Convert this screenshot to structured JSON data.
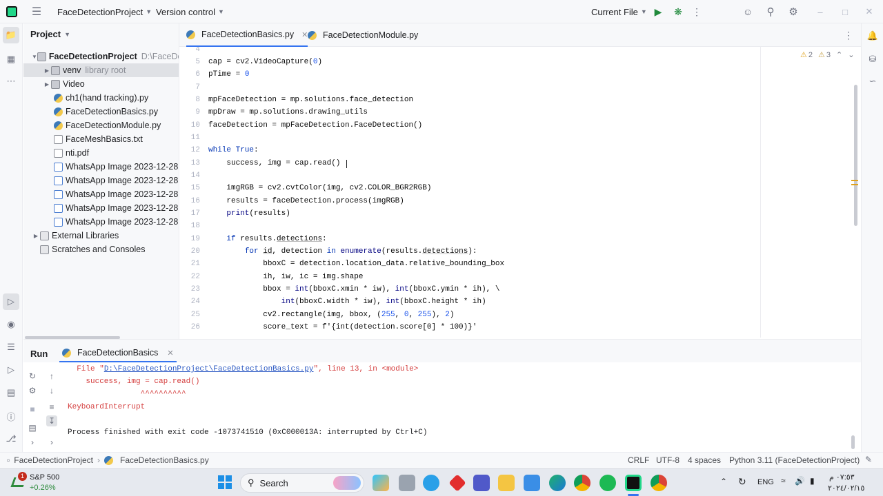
{
  "titlebar": {
    "project_name": "FaceDetectionProject",
    "vcs": "Version control",
    "run_config": "Current File"
  },
  "project_panel": {
    "title": "Project",
    "root": {
      "name": "FaceDetectionProject",
      "path": "D:\\FaceDe"
    },
    "items": [
      {
        "label": "venv",
        "hint": "library root"
      },
      {
        "label": "Video",
        "hint": ""
      },
      {
        "label": "ch1(hand tracking).py",
        "hint": ""
      },
      {
        "label": "FaceDetectionBasics.py",
        "hint": ""
      },
      {
        "label": "FaceDetectionModule.py",
        "hint": ""
      },
      {
        "label": "FaceMeshBasics.txt",
        "hint": ""
      },
      {
        "label": "nti.pdf",
        "hint": ""
      },
      {
        "label": "WhatsApp Image 2023-12-28 at",
        "hint": ""
      },
      {
        "label": "WhatsApp Image 2023-12-28 at",
        "hint": ""
      },
      {
        "label": "WhatsApp Image 2023-12-28 at",
        "hint": ""
      },
      {
        "label": "WhatsApp Image 2023-12-28 at",
        "hint": ""
      },
      {
        "label": "WhatsApp Image 2023-12-28 at",
        "hint": ""
      },
      {
        "label": "External Libraries",
        "hint": ""
      },
      {
        "label": "Scratches and Consoles",
        "hint": ""
      }
    ]
  },
  "editor": {
    "tabs": [
      "FaceDetectionBasics.py",
      "FaceDetectionModule.py"
    ],
    "warnings": "2",
    "weak_warnings": "3",
    "line_numbers": [
      "4",
      "5",
      "6",
      "7",
      "8",
      "9",
      "10",
      "11",
      "12",
      "13",
      "14",
      "15",
      "16",
      "17",
      "18",
      "19",
      "20",
      "21",
      "22",
      "23",
      "24",
      "25",
      "26"
    ],
    "code": {
      "l5a": "cap = cv2.VideoCapture(",
      "l5b": "0",
      "l5c": ")",
      "l6a": "pTime = ",
      "l6b": "0",
      "l8": "mpFaceDetection = mp.solutions.face_detection",
      "l9": "mpDraw = mp.solutions.drawing_utils",
      "l10": "faceDetection = mpFaceDetection.FaceDetection()",
      "l12a": "while ",
      "l12b": "True",
      "l12c": ":",
      "l13": "    success, img = cap.read()",
      "l15": "    imgRGB = cv2.cvtColor(img, cv2.COLOR_BGR2RGB)",
      "l16": "    results = faceDetection.process(imgRGB)",
      "l17a": "    ",
      "l17b": "print",
      "l17c": "(results)",
      "l19a": "    ",
      "l19b": "if ",
      "l19c": "results.",
      "l19d": "detections",
      "l19e": ":",
      "l20a": "        ",
      "l20b": "for ",
      "l20c": "id",
      "l20d": ", detection ",
      "l20e": "in ",
      "l20f": "enumerate",
      "l20g": "(results.",
      "l20h": "detections",
      "l20i": "):",
      "l21": "            bboxC = detection.location_data.relative_bounding_box",
      "l22": "            ih, iw, ic = img.shape",
      "l23a": "            bbox = ",
      "l23b": "int",
      "l23c": "(bboxC.xmin * iw), ",
      "l23d": "int",
      "l23e": "(bboxC.ymin * ih), \\",
      "l24a": "                ",
      "l24b": "int",
      "l24c": "(bboxC.width * iw), ",
      "l24d": "int",
      "l24e": "(bboxC.height * ih)",
      "l25a": "            cv2.rectangle(img, bbox, (",
      "l25b": "255",
      "l25c": ", ",
      "l25d": "0",
      "l25e": ", ",
      "l25f": "255",
      "l25g": "), ",
      "l25h": "2",
      "l25i": ")",
      "l26": "            score_text = f'{int(detection.score[0] * 100)}'"
    }
  },
  "run": {
    "title": "Run",
    "tab": "FaceDetectionBasics",
    "lines": {
      "file_prefix": "  File \"",
      "file_link": "D:\\FaceDetectionProject\\FaceDetectionBasics.py",
      "file_suffix": "\", line 13, in <module>",
      "code": "    success, img = cap.read()",
      "caret": "                ^^^^^^^^^^",
      "exception": "KeyboardInterrupt",
      "finish": "Process finished with exit code -1073741510 (0xC000013A: interrupted by Ctrl+C)"
    }
  },
  "statusbar": {
    "crumb_project": "FaceDetectionProject",
    "crumb_file": "FaceDetectionBasics.py",
    "line_sep": "CRLF",
    "encoding": "UTF-8",
    "indent": "4 spaces",
    "interpreter": "Python 3.11 (FaceDetectionProject)"
  },
  "taskbar": {
    "stock_name": "S&P 500",
    "stock_change": "+0.26%",
    "stock_badge": "1",
    "search": "Search",
    "lang": "ENG",
    "time": "٠٧:٥٣ م",
    "date": "٢٠٢٤/٠٢/١٥",
    "accent_color": "#3574f0"
  }
}
